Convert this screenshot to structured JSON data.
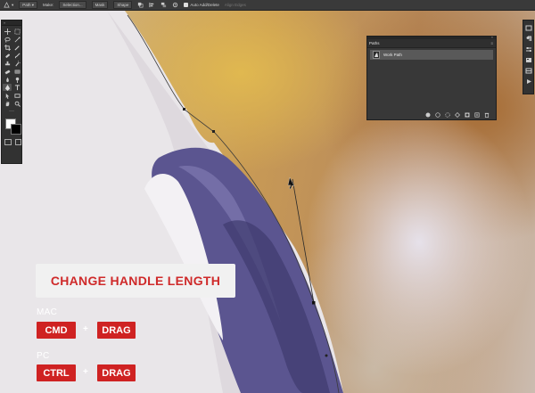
{
  "options_bar": {
    "mode_value": "Path",
    "make_label": "Make:",
    "selection_button": "Selection...",
    "mask_button": "Mask",
    "shape_button": "Shape",
    "auto_add_delete_label": "Auto Add/Delete",
    "auto_add_delete_checked": true,
    "align_edges_label": "Align Edges"
  },
  "paths_panel": {
    "tab_label": "Paths",
    "items": [
      {
        "label": "Work Path"
      }
    ]
  },
  "overlay": {
    "title": "CHANGE HANDLE LENGTH",
    "mac_label": "MAC",
    "mac_key_1": "CMD",
    "mac_key_2": "DRAG",
    "pc_label": "PC",
    "pc_key_1": "CTRL",
    "pc_key_2": "DRAG",
    "plus": "+"
  },
  "colors": {
    "accent_red": "#cf2222",
    "title_text": "#cf2a2a",
    "foreground_swatch": "#ffffff",
    "background_swatch": "#000000"
  },
  "toolbar_icons": [
    "move-icon",
    "marquee-icon",
    "lasso-icon",
    "magic-wand-icon",
    "crop-icon",
    "eyedropper-icon",
    "healing-icon",
    "brush-icon",
    "clone-stamp-icon",
    "history-brush-icon",
    "eraser-icon",
    "gradient-icon",
    "blur-icon",
    "dodge-icon",
    "pen-icon",
    "type-icon",
    "path-select-icon",
    "rectangle-icon",
    "hand-icon",
    "zoom-icon"
  ]
}
